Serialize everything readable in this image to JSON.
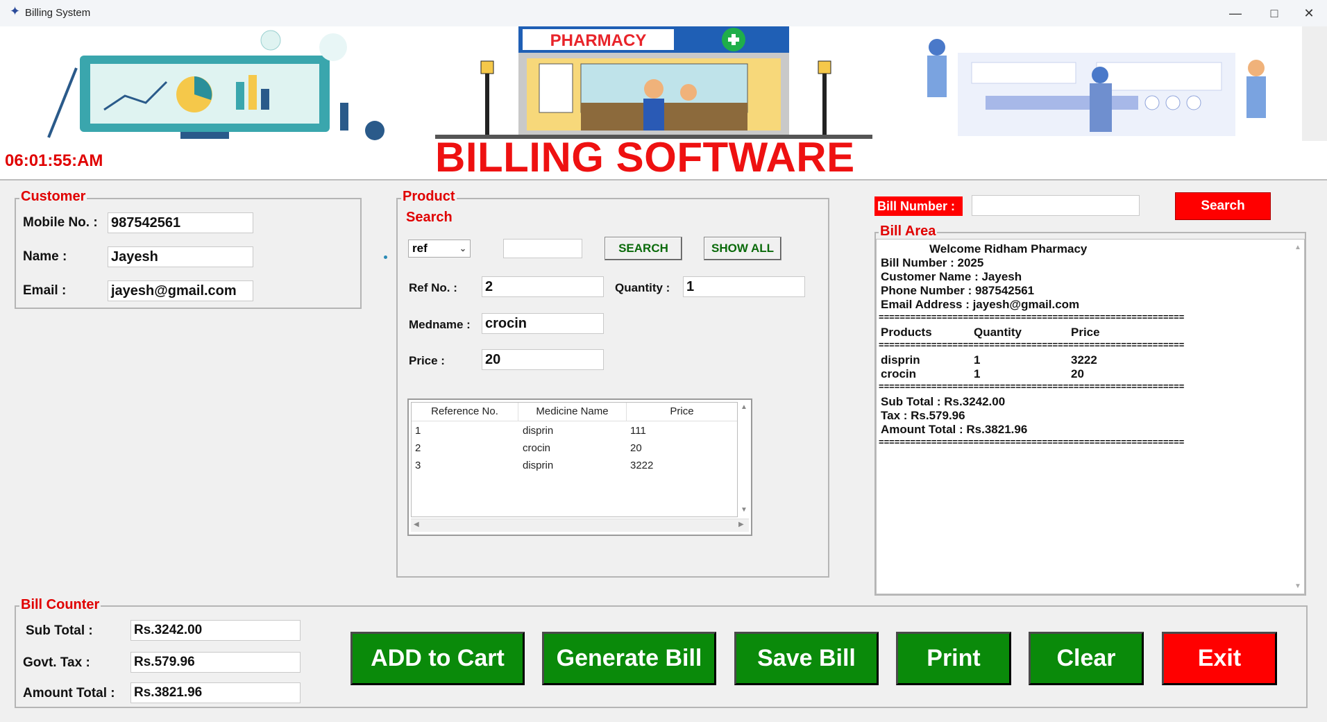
{
  "window": {
    "title": "Billing System"
  },
  "header": {
    "clock": "06:01:55:AM",
    "headline": "BILLING SOFTWARE",
    "pharmacy_sign": "PHARMACY"
  },
  "customer": {
    "legend": "Customer",
    "mobile_label": "Mobile No. :",
    "mobile_value": "987542561",
    "name_label": "Name :",
    "name_value": "Jayesh",
    "email_label": "Email :",
    "email_value": "jayesh@gmail.com"
  },
  "product": {
    "legend": "Product",
    "search_label": "Search",
    "search_by": "ref",
    "search_text": "",
    "search_button": "SEARCH",
    "show_all_button": "SHOW ALL",
    "ref_label": "Ref No. :",
    "ref_value": "2",
    "quantity_label": "Quantity :",
    "quantity_value": "1",
    "medname_label": "Medname :",
    "medname_value": "crocin",
    "price_label": "Price :",
    "price_value": "20",
    "table": {
      "headers": [
        "Reference No.",
        "Medicine Name",
        "Price"
      ],
      "rows": [
        [
          "1",
          "disprin",
          "111"
        ],
        [
          "2",
          "crocin",
          "20"
        ],
        [
          "3",
          "disprin",
          "3222"
        ]
      ]
    }
  },
  "bill": {
    "number_label": "Bill Number :",
    "number_value": "",
    "search_button": "Search",
    "area_legend": "Bill Area",
    "lines": {
      "welcome": "Welcome Ridham Pharmacy",
      "bill_number": "Bill Number : 2025",
      "customer_name": "Customer Name : Jayesh",
      "phone": "Phone Number : 987542561",
      "email": "Email Address : jayesh@gmail.com",
      "separator": "==========================================================",
      "col_products": "Products",
      "col_quantity": "Quantity",
      "col_price": "Price",
      "items": [
        [
          "disprin",
          "1",
          "3222"
        ],
        [
          "crocin",
          "1",
          "20"
        ]
      ],
      "sub_total": "Sub Total : Rs.3242.00",
      "tax": "Tax : Rs.579.96",
      "amount_total": "Amount Total : Rs.3821.96"
    }
  },
  "counter": {
    "legend": "Bill Counter",
    "sub_total_label": "Sub Total :",
    "sub_total_value": "Rs.3242.00",
    "tax_label": "Govt. Tax :",
    "tax_value": "Rs.579.96",
    "amount_label": "Amount Total :",
    "amount_value": "Rs.3821.96"
  },
  "buttons": {
    "add_to_cart": "ADD to Cart",
    "generate_bill": "Generate Bill",
    "save_bill": "Save Bill",
    "print": "Print",
    "clear": "Clear",
    "exit": "Exit"
  },
  "colors": {
    "accent_red": "#e00000",
    "button_green": "#0a8a0a",
    "exit_red": "#ff0000"
  },
  "icons": [
    "feather-icon",
    "minimize-icon",
    "maximize-icon",
    "close-icon",
    "chevron-down-icon",
    "scroll-up-icon",
    "scroll-down-icon",
    "scroll-left-icon",
    "scroll-right-icon"
  ]
}
